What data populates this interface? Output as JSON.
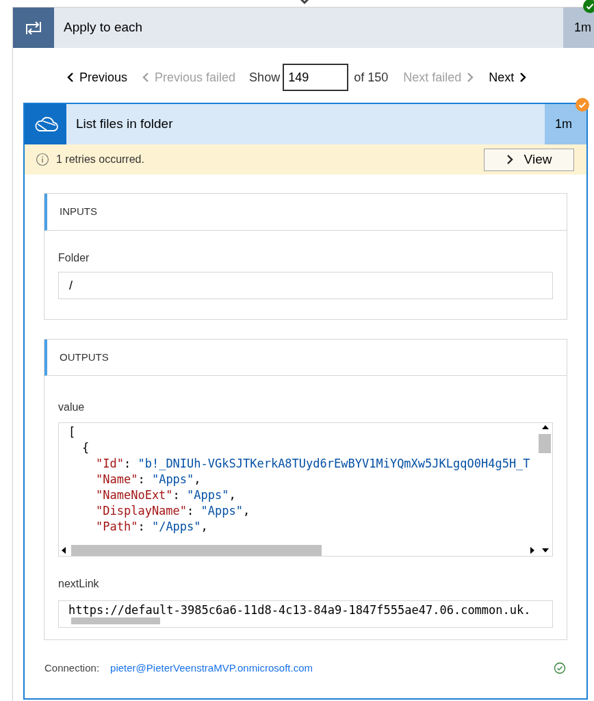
{
  "loop": {
    "title": "Apply to each",
    "duration": "1m",
    "color": "#107c10"
  },
  "pager": {
    "previous": {
      "label": "Previous",
      "disabled": false
    },
    "previous_failed": {
      "label": "Previous failed",
      "disabled": true
    },
    "show_label": "Show",
    "value": "149",
    "of_label": "of 150",
    "next_failed": {
      "label": "Next failed",
      "disabled": true
    },
    "next": {
      "label": "Next",
      "disabled": false
    }
  },
  "action": {
    "title": "List files in folder",
    "duration": "1m",
    "color": "#f7912b",
    "selected": true,
    "warning": {
      "text": "1 retries occurred.",
      "button": "View"
    },
    "inputs": {
      "heading": "INPUTS",
      "fields": [
        {
          "label": "Folder",
          "value": "/"
        }
      ]
    },
    "outputs": {
      "heading": "OUTPUTS",
      "value_label": "value",
      "value_lines": [
        [
          {
            "kind": "punct",
            "text": "["
          }
        ],
        [
          {
            "kind": "punct",
            "text": "{"
          }
        ],
        [
          {
            "kind": "key",
            "text": "\"Id\""
          },
          {
            "kind": "punct",
            "text": ": "
          },
          {
            "kind": "string",
            "text": "\"b!_DNIUh-VGkSJTKerkA8TUyd6rEwBYV1MiYQmXw5JKLgqO0H4g5H_T"
          }
        ],
        [
          {
            "kind": "key",
            "text": "\"Name\""
          },
          {
            "kind": "punct",
            "text": ": "
          },
          {
            "kind": "string",
            "text": "\"Apps\""
          },
          {
            "kind": "punct",
            "text": ","
          }
        ],
        [
          {
            "kind": "key",
            "text": "\"NameNoExt\""
          },
          {
            "kind": "punct",
            "text": ": "
          },
          {
            "kind": "string",
            "text": "\"Apps\""
          },
          {
            "kind": "punct",
            "text": ","
          }
        ],
        [
          {
            "kind": "key",
            "text": "\"DisplayName\""
          },
          {
            "kind": "punct",
            "text": ": "
          },
          {
            "kind": "string",
            "text": "\"Apps\""
          },
          {
            "kind": "punct",
            "text": ","
          }
        ],
        [
          {
            "kind": "key",
            "text": "\"Path\""
          },
          {
            "kind": "punct",
            "text": ": "
          },
          {
            "kind": "string",
            "text": "\"/Apps\""
          },
          {
            "kind": "punct",
            "text": ","
          }
        ]
      ],
      "next_link_label": "nextLink",
      "next_link": "https://default-3985c6a6-11d8-4c13-84a9-1847f555ae47.06.common.uk."
    },
    "connection": {
      "label": "Connection:",
      "account": "pieter@PieterVeenstraMVP.onmicrosoft.com",
      "verified": true
    }
  }
}
